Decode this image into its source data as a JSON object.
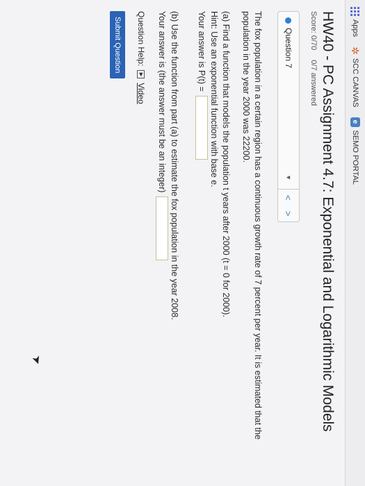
{
  "bookmarks": [
    {
      "label": "Apps",
      "icon": "apps-grid-icon"
    },
    {
      "label": "SCC CANVAS",
      "icon": "scc-star-icon"
    },
    {
      "label": "SEMO PORTAL",
      "icon": "semo-e-icon"
    }
  ],
  "assignment": {
    "title": "HW40 - PC Assignment 4.7: Exponential and Logarithmic Models",
    "score": "Score: 0/70",
    "answered": "0/7 answered"
  },
  "question_nav": {
    "selected": "Question 7",
    "prev": "<",
    "next": ">"
  },
  "question": {
    "intro": "The fox population in a certain region has a continuous growth rate of 7 percent per year. It is estimated that the population in the year 2000 was 22200.",
    "part_a": "(a) Find a function that models the population t years after 2000 (t = 0 for 2000).",
    "hint": "Hint: Use an exponential function with base e.",
    "answer_a_label": "Your answer is P(t) =",
    "part_b": "(b) Use the function from part (a) to estimate the fox population in the year 2008.",
    "answer_b_label": "Your answer is (the answer must be an integer)"
  },
  "help": {
    "label": "Question Help:",
    "video_label": "Video"
  },
  "submit_label": "Submit Question"
}
